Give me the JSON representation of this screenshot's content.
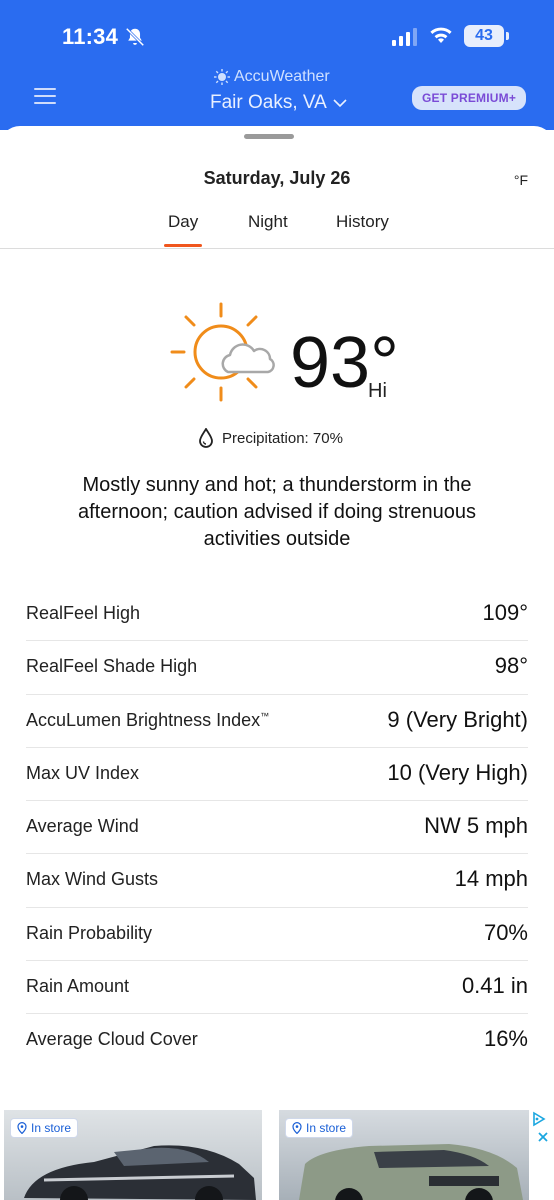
{
  "status_bar": {
    "time": "11:34",
    "battery": "43"
  },
  "app": {
    "brand": "AccuWeather",
    "location": "Fair Oaks, VA",
    "premium_button": "GET PREMIUM+"
  },
  "sheet": {
    "date": "Saturday, July 26",
    "unit": "°F",
    "tabs": [
      {
        "label": "Day"
      },
      {
        "label": "Night"
      },
      {
        "label": "History"
      }
    ],
    "selected_tab": "Day"
  },
  "forecast": {
    "icon": "partly-sunny-icon",
    "temperature": "93°",
    "temp_label": "Hi",
    "precipitation": "Precipitation: 70%",
    "description": "Mostly sunny and hot; a thunderstorm in the afternoon; caution advised if doing strenuous activities outside"
  },
  "details": [
    {
      "label": "RealFeel High",
      "value": "109°"
    },
    {
      "label": "RealFeel Shade High",
      "value": "98°"
    },
    {
      "label": "AccuLumen Brightness Index",
      "value": "9 (Very Bright)",
      "tm": "™"
    },
    {
      "label": "Max UV Index",
      "value": "10 (Very High)"
    },
    {
      "label": "Average Wind",
      "value": "NW 5 mph"
    },
    {
      "label": "Max Wind Gusts",
      "value": "14 mph"
    },
    {
      "label": "Rain Probability",
      "value": "70%"
    },
    {
      "label": "Rain Amount",
      "value": "0.41 in"
    },
    {
      "label": "Average Cloud Cover",
      "value": "16%"
    }
  ],
  "ads": [
    {
      "badge": "In store"
    },
    {
      "badge": "In store"
    }
  ],
  "colors": {
    "header_blue": "#2a6cf0",
    "tab_accent": "#f0561d",
    "sun_orange": "#f08c1a",
    "premium_text": "#7a4bd6"
  }
}
